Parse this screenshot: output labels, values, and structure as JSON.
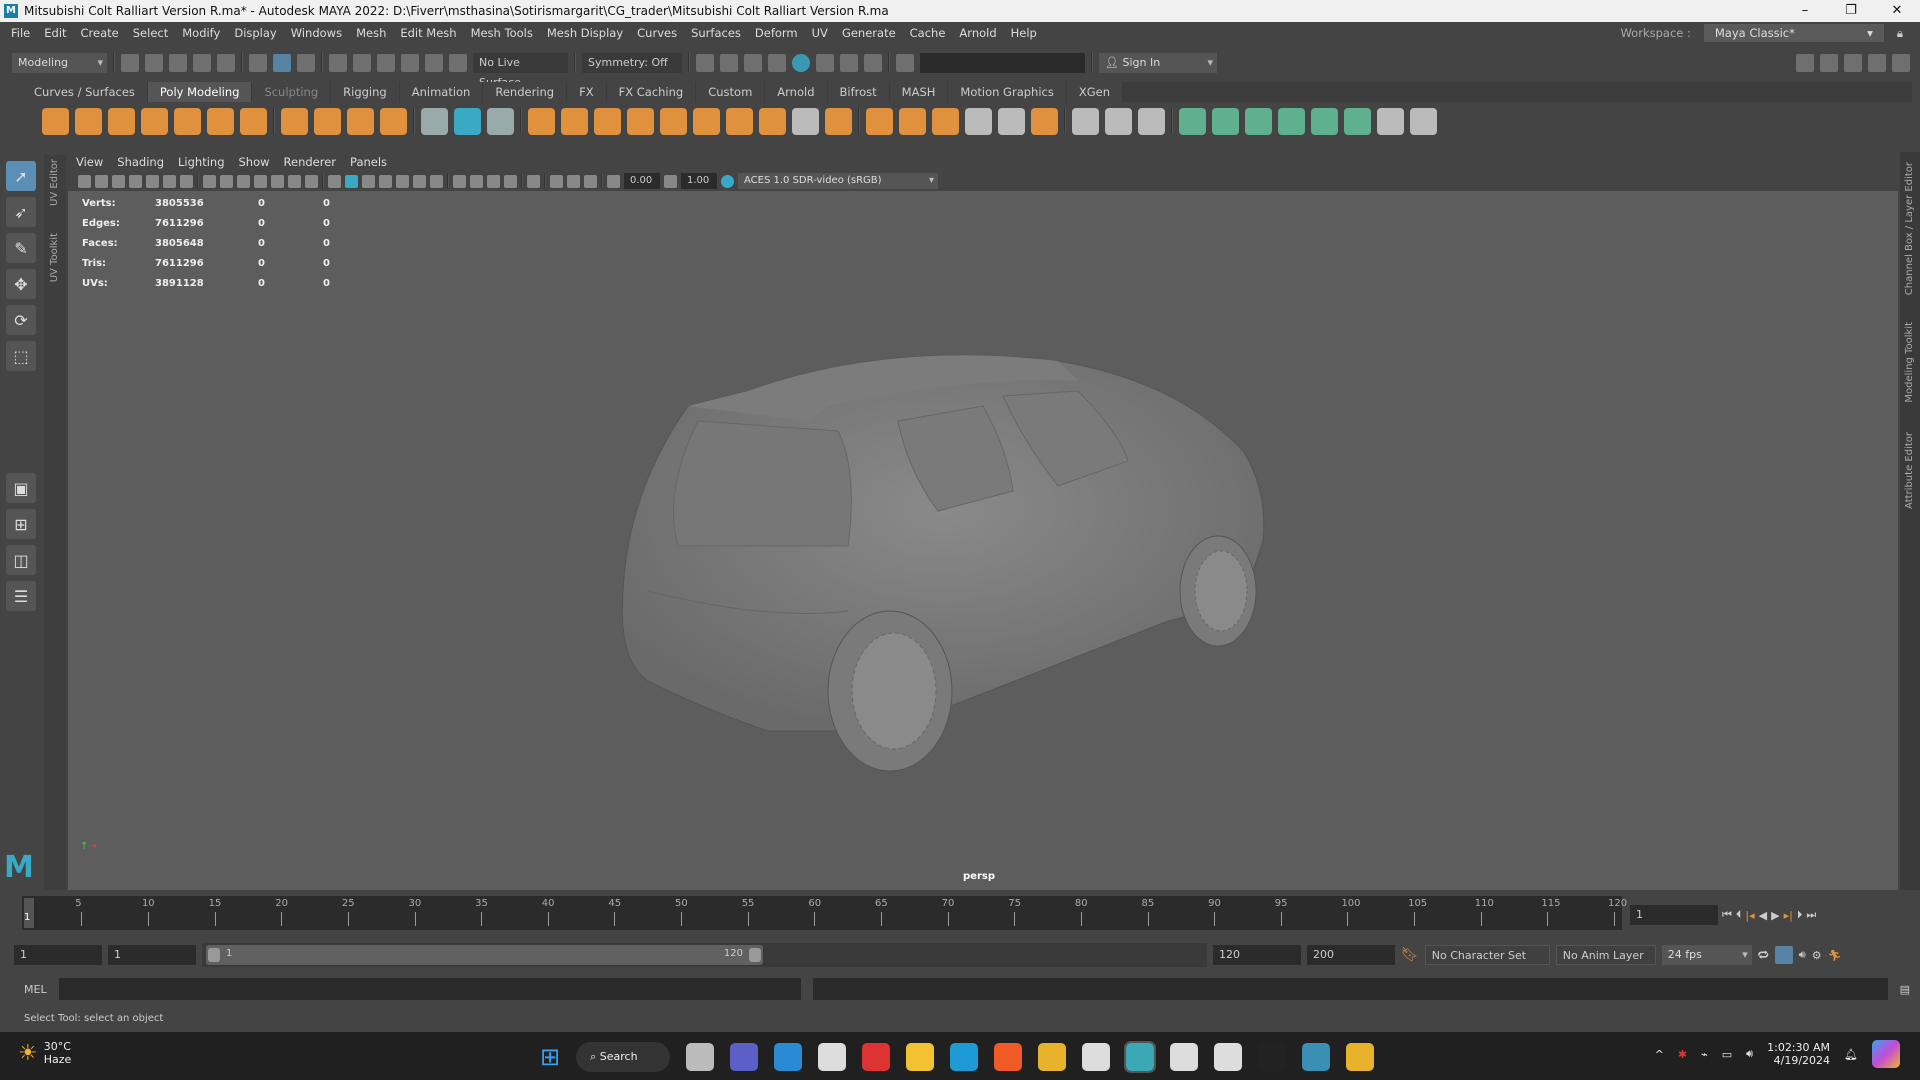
{
  "title": "Mitsubishi Colt Ralliart Version R.ma* - Autodesk MAYA 2022: D:\\Fiverr\\msthasina\\Sotirismargarit\\CG_trader\\Mitsubishi Colt Ralliart Version R.ma",
  "menu": [
    "File",
    "Edit",
    "Create",
    "Select",
    "Modify",
    "Display",
    "Windows",
    "Mesh",
    "Edit Mesh",
    "Mesh Tools",
    "Mesh Display",
    "Curves",
    "Surfaces",
    "Deform",
    "UV",
    "Generate",
    "Cache",
    "Arnold",
    "Help"
  ],
  "workspace": {
    "label": "Workspace :",
    "value": "Maya Classic*"
  },
  "status": {
    "mode": "Modeling",
    "live_surface": "No Live Surface",
    "symmetry": "Symmetry: Off",
    "sign_in": "Sign In"
  },
  "shelf_tabs": [
    "Curves / Surfaces",
    "Poly Modeling",
    "Sculpting",
    "Rigging",
    "Animation",
    "Rendering",
    "FX",
    "FX Caching",
    "Custom",
    "Arnold",
    "Bifrost",
    "MASH",
    "Motion Graphics",
    "XGen"
  ],
  "shelf_active": "Poly Modeling",
  "shelf_icons": [
    {
      "name": "poly-sphere-icon",
      "color": "#e0913d"
    },
    {
      "name": "poly-cube-icon",
      "color": "#e0913d"
    },
    {
      "name": "poly-cylinder-icon",
      "color": "#e0913d"
    },
    {
      "name": "poly-cone-icon",
      "color": "#e0913d"
    },
    {
      "name": "poly-torus-icon",
      "color": "#e0913d"
    },
    {
      "name": "poly-plane-icon",
      "color": "#e0913d"
    },
    {
      "name": "poly-disc-icon",
      "color": "#e0913d"
    },
    {
      "name": "platonic-solid-icon",
      "color": "#e0913d"
    },
    {
      "name": "super-shape-icon",
      "color": "#e0913d"
    },
    {
      "name": "type-icon",
      "color": "#e0913d"
    },
    {
      "name": "svg-icon",
      "color": "#e0913d"
    },
    {
      "name": "sweep-icon",
      "color": "#9aa"
    },
    {
      "name": "bevel-icon",
      "color": "#3aa9c6"
    },
    {
      "name": "snowflake-icon",
      "color": "#9aa"
    },
    {
      "name": "combine-icon",
      "color": "#e0913d"
    },
    {
      "name": "separate-icon",
      "color": "#e0913d"
    },
    {
      "name": "extract-icon",
      "color": "#e0913d"
    },
    {
      "name": "smooth-icon",
      "color": "#e0913d"
    },
    {
      "name": "boolean-icon",
      "color": "#e0913d"
    },
    {
      "name": "mirror-icon",
      "color": "#e0913d"
    },
    {
      "name": "merge-icon",
      "color": "#e0913d"
    },
    {
      "name": "extrude-icon",
      "color": "#e0913d"
    },
    {
      "name": "bridge-icon",
      "color": "#bbb"
    },
    {
      "name": "fill-hole-icon",
      "color": "#e0913d"
    },
    {
      "name": "append-icon",
      "color": "#e0913d"
    },
    {
      "name": "target-weld-icon",
      "color": "#e0913d"
    },
    {
      "name": "wedge-icon",
      "color": "#e0913d"
    },
    {
      "name": "poke-icon",
      "color": "#bbb"
    },
    {
      "name": "multi-cut-icon",
      "color": "#bbb"
    },
    {
      "name": "edge-loop-icon",
      "color": "#e0913d"
    },
    {
      "name": "connect-icon",
      "color": "#bbb"
    },
    {
      "name": "uv-planar-icon",
      "color": "#bbb"
    },
    {
      "name": "uv-auto-icon",
      "color": "#bbb"
    },
    {
      "name": "uv-editor-icon",
      "color": "#5fb08f"
    },
    {
      "name": "uv-cut-icon",
      "color": "#5fb08f"
    },
    {
      "name": "uv-sew-icon",
      "color": "#5fb08f"
    },
    {
      "name": "uv-unfold-icon",
      "color": "#5fb08f"
    },
    {
      "name": "uv-layout-icon",
      "color": "#5fb08f"
    },
    {
      "name": "checker-icon",
      "color": "#5fb08f"
    },
    {
      "name": "uv-shell-icon",
      "color": "#bbb"
    },
    {
      "name": "uv-delete-icon",
      "color": "#bbb"
    }
  ],
  "panel_menu": [
    "View",
    "Shading",
    "Lighting",
    "Show",
    "Renderer",
    "Panels"
  ],
  "viewport_toolbar": {
    "exposure": "0.00",
    "gamma": "1.00",
    "color_space": "ACES 1.0 SDR-video (sRGB)"
  },
  "hud": [
    {
      "label": "Verts:",
      "v": "3805536",
      "a": "0",
      "b": "0"
    },
    {
      "label": "Edges:",
      "v": "7611296",
      "a": "0",
      "b": "0"
    },
    {
      "label": "Faces:",
      "v": "3805648",
      "a": "0",
      "b": "0"
    },
    {
      "label": "Tris:",
      "v": "7611296",
      "a": "0",
      "b": "0"
    },
    {
      "label": "UVs:",
      "v": "3891128",
      "a": "0",
      "b": "0"
    }
  ],
  "camera": "persp",
  "side_tabs": [
    "Channel Box / Layer Editor",
    "Modeling Toolkit",
    "Attribute Editor"
  ],
  "left_tabs": [
    "UV Editor",
    "UV Toolkit"
  ],
  "timeline": {
    "ticks": [
      5,
      10,
      15,
      20,
      25,
      30,
      35,
      40,
      45,
      50,
      55,
      60,
      65,
      70,
      75,
      80,
      85,
      90,
      95,
      100,
      105,
      110,
      115,
      120
    ],
    "current": "1",
    "current_field": "1",
    "min": 1,
    "max": 120
  },
  "range": {
    "start": "1",
    "start2": "1",
    "slider_start": "1",
    "slider_end": "120",
    "end": "120",
    "end2": "200",
    "character_set": "No Character Set",
    "anim_layer": "No Anim Layer",
    "fps": "24 fps"
  },
  "mel_label": "MEL",
  "help_line": "Select Tool: select an object",
  "taskbar": {
    "weather_temp": "30°C",
    "weather_desc": "Haze",
    "search": "Search",
    "time": "1:02:30 AM",
    "date": "4/19/2024",
    "apps": [
      {
        "name": "task-view-icon",
        "color": "#bbb"
      },
      {
        "name": "teams-icon",
        "color": "#5b5fc7"
      },
      {
        "name": "mail-icon",
        "color": "#2a8ad4"
      },
      {
        "name": "store-icon",
        "color": "#ddd"
      },
      {
        "name": "acrobat-icon",
        "color": "#d33"
      },
      {
        "name": "file-explorer-icon",
        "color": "#f2c233"
      },
      {
        "name": "edge-icon",
        "color": "#1e9ad6"
      },
      {
        "name": "brave-icon",
        "color": "#f05a24"
      },
      {
        "name": "chrome-icon",
        "color": "#e8b22b"
      },
      {
        "name": "zbrush-icon",
        "color": "#ddd"
      },
      {
        "name": "maya-icon",
        "color": "#3aa9b5"
      },
      {
        "name": "unreal-icon",
        "color": "#ddd"
      },
      {
        "name": "unity-icon",
        "color": "#ddd"
      },
      {
        "name": "epic-games-icon",
        "color": "#222"
      },
      {
        "name": "maya-alt-icon",
        "color": "#3a8fb5"
      },
      {
        "name": "chrome-alt-icon",
        "color": "#e8b22b"
      }
    ]
  }
}
